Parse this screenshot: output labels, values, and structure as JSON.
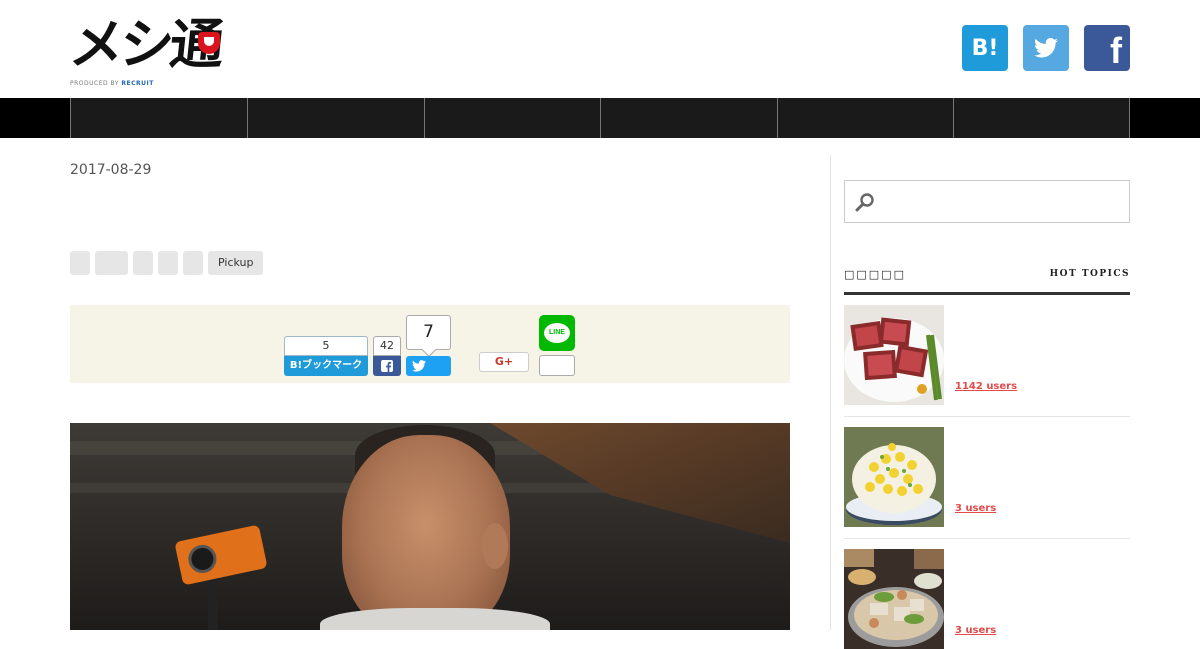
{
  "site": {
    "logo_text": "メシ通",
    "logo_sub_prefix": "PRODUCED BY ",
    "logo_sub_brand": "RECRUIT"
  },
  "header": {
    "social": [
      {
        "name": "hatena",
        "glyph": "B!",
        "color": "#1e9bd8"
      },
      {
        "name": "twitter",
        "color": "#56a8e0"
      },
      {
        "name": "facebook",
        "glyph": "f",
        "color": "#3b5998"
      }
    ]
  },
  "nav": {
    "item_count": 6
  },
  "article": {
    "date": "2017-08-29",
    "tags": [
      "",
      "",
      "",
      "",
      "",
      "Pickup"
    ],
    "share": {
      "hatena_count": "5",
      "hatena_label": "B!ブックマーク",
      "facebook_count": "42",
      "twitter_count": "7",
      "google_label": "G+",
      "line_label": "LINE"
    }
  },
  "sidebar": {
    "search": {
      "placeholder": "",
      "value": ""
    },
    "popular": {
      "title_jp": "□□□□□",
      "title_en": "HOT TOPICS",
      "items": [
        {
          "users": "1142 users"
        },
        {
          "users": "3 users"
        },
        {
          "users": "3 users"
        }
      ]
    }
  },
  "colors": {
    "accent_red": "#e34a4a",
    "nav_bg": "#1a1a1a",
    "share_bg": "#f6f4e7",
    "hatena": "#1e9bd8",
    "twitter": "#1da1f2",
    "facebook": "#3b5998",
    "line": "#00b900"
  }
}
